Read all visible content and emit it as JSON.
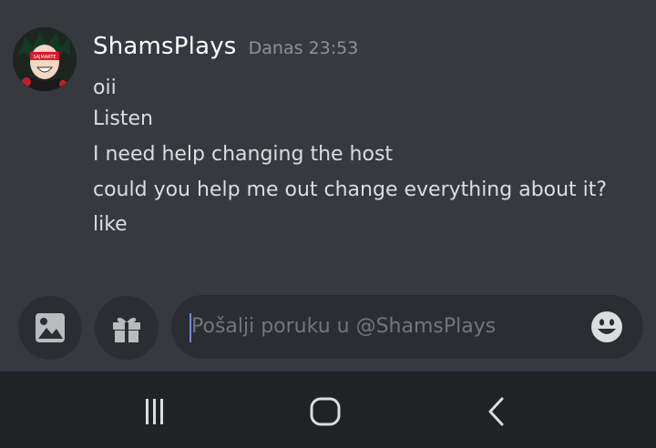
{
  "message": {
    "author": "ShamsPlays",
    "timestamp": "Danas 23:53",
    "avatar_icon": "anime-avatar",
    "lines": [
      "oii",
      "Listen",
      "I need help changing the host",
      "could you help me out change everything about it?",
      "like"
    ]
  },
  "composer": {
    "placeholder": "Pošalji poruku u @ShamsPlays",
    "buttons": {
      "image": "image-icon",
      "gift": "gift-icon",
      "emoji": "emoji-icon"
    }
  },
  "navbar": {
    "buttons": [
      "recent-apps-icon",
      "home-icon",
      "back-icon"
    ]
  },
  "colors": {
    "background": "#36393f",
    "input": "#2a2d31",
    "navbar": "#202225",
    "author": "#ffffff",
    "text": "#dcddde",
    "muted": "#8e9297",
    "accent": "#7289da"
  }
}
